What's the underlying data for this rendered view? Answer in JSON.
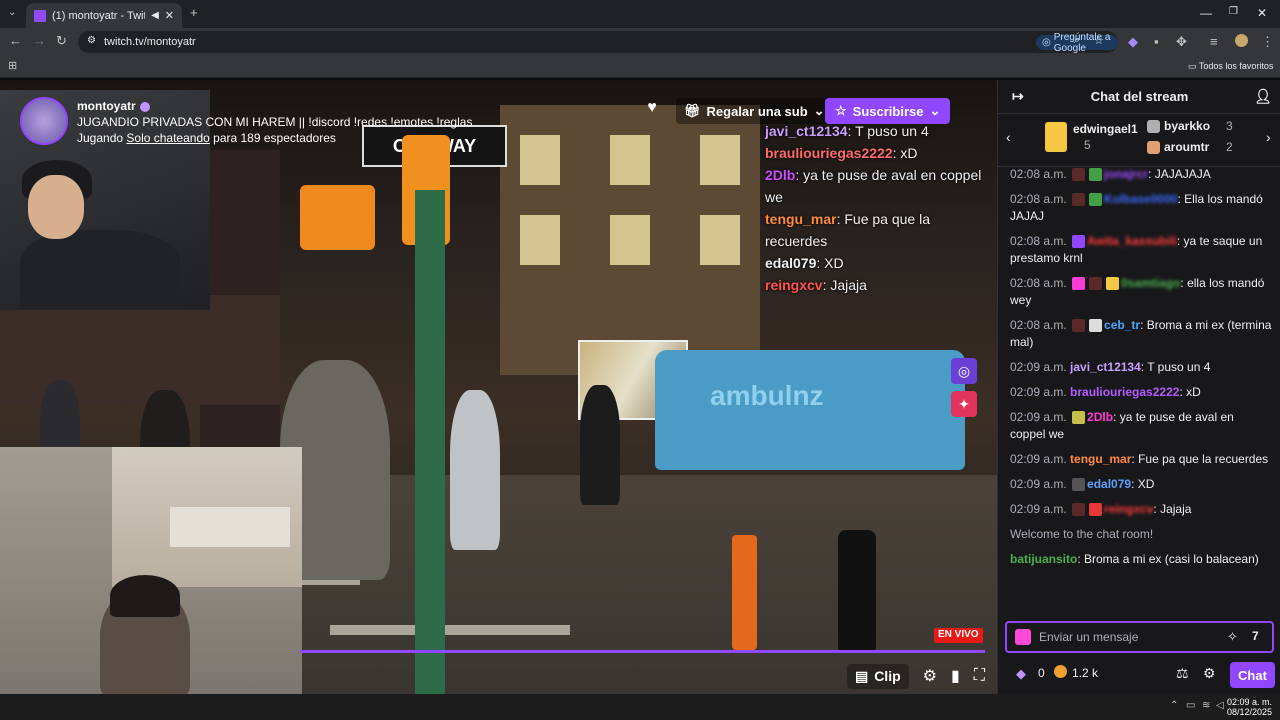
{
  "browser": {
    "tab_title": "(1) montoyatr - Twitch",
    "url": "twitch.tv/montoyatr",
    "google_btn": "Pregúntale a Google",
    "bookmarks_label": "Todos los favoritos"
  },
  "stream": {
    "streamer": "montoyatr",
    "title": "JUGANDIO PRIVADAS CON MI HAREM || !discord !redes !emotes !reglas",
    "playing_prefix": "Jugando",
    "game": "Solo chateando",
    "viewers_text": "para 189 espectadores",
    "gift_label": "Regalar una sub",
    "subscribe_label": "Suscribirse",
    "live_label": "EN VIVO",
    "clip_label": "Clip",
    "sign_text": "ONE WAY",
    "van_text": "ambulnz"
  },
  "overlay_chat": [
    {
      "user": "javi_ct12134",
      "color": "#c99cff",
      "text": "T puso un 4"
    },
    {
      "user": "brauliouriegas2222",
      "color": "#ff6a6a",
      "text": "xD"
    },
    {
      "user": "2Dlb",
      "color": "#c94cff",
      "text": "ya te puse de aval en coppel we"
    },
    {
      "user": "tengu_mar",
      "color": "#ff8b3d",
      "text": "Fue pa que la recuerdes"
    },
    {
      "user": "edal079",
      "color": "#efeff1",
      "text": "XD"
    },
    {
      "user": "reingxcv",
      "color": "#ff5252",
      "text": "Jajaja"
    }
  ],
  "chat": {
    "header": "Chat del stream",
    "gifters": [
      {
        "name": "edwingael1",
        "count": "5"
      },
      {
        "name": "byarkko",
        "count": "3"
      },
      {
        "name": "aroumtr",
        "count": "2"
      }
    ],
    "messages": [
      {
        "time": "02:08 a.m.",
        "user": "jonajrcr",
        "color": "#9d4dff",
        "text": ": JAJAJAJA",
        "blur": true
      },
      {
        "time": "02:08 a.m.",
        "user": "Kolbase0000",
        "color": "#3a6bff",
        "text": ": Ella los mandó JAJAJ",
        "blur": true
      },
      {
        "time": "02:08 a.m.",
        "user": "Awita_kassubili",
        "color": "#ff3b3b",
        "text": ": ya te saque un prestamo krnl",
        "blur": true
      },
      {
        "time": "02:08 a.m.",
        "user": "0samtiago",
        "color": "#4caf50",
        "text": ": ella los mandó wey",
        "blur": true
      },
      {
        "time": "02:08 a.m.",
        "user": "ceb_tr",
        "color": "#4aa3ff",
        "text": ": Broma a mi ex (termina mal)",
        "blur": false
      },
      {
        "time": "02:09 a.m.",
        "user": "javi_ct12134",
        "color": "#c99cff",
        "text": ": T puso un 4",
        "blur": false
      },
      {
        "time": "02:09 a.m.",
        "user": "brauliouriegas2222",
        "color": "#b45cff",
        "text": ": xD",
        "blur": false
      },
      {
        "time": "02:09 a.m.",
        "user": "2Dlb",
        "color": "#ff3bd6",
        "text": ": ya te puse de aval en coppel we",
        "blur": false
      },
      {
        "time": "02:09 a.m.",
        "user": "tengu_mar",
        "color": "#ff8b3d",
        "text": ": Fue pa que la recuerdes",
        "blur": false
      },
      {
        "time": "02:09 a.m.",
        "user": "edal079",
        "color": "#5aa0ff",
        "text": ": XD",
        "blur": false
      },
      {
        "time": "02:09 a.m.",
        "user": "reingxcv",
        "color": "#ff3b3b",
        "text": ": Jajaja",
        "blur": true
      }
    ],
    "welcome": "Welcome to the chat room!",
    "last": {
      "user": "batijuansito",
      "color": "#4caf50",
      "text": ": Broma a mi ex (casi lo balacean)"
    },
    "input_placeholder": "Enviar un mensaje",
    "points_a": "0",
    "points_b": "1.2 k",
    "chat_button": "Chat"
  },
  "taskbar": {
    "time": "02:09 a. m.",
    "date": "08/12/2025"
  }
}
